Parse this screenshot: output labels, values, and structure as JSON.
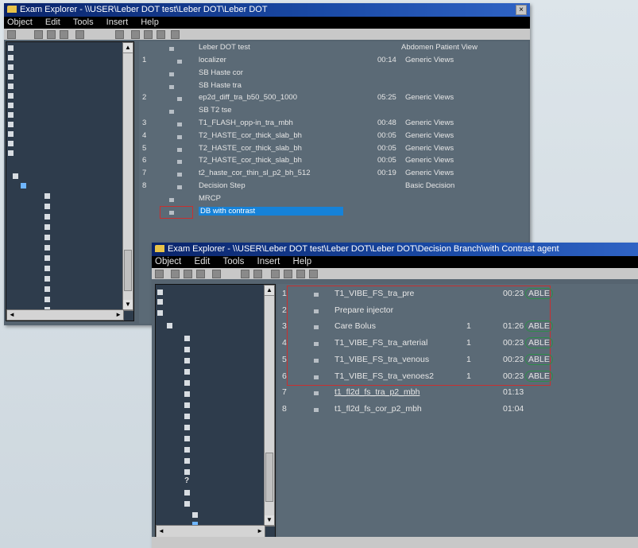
{
  "window1": {
    "title": "Exam Explorer - \\\\USER\\Leber DOT test\\Leber DOT\\Leber DOT",
    "close_glyph": "×",
    "menu": [
      "Object",
      "Edit",
      "Tools",
      "Insert",
      "Help"
    ],
    "header": {
      "name": "Leber DOT test",
      "view": "Abdomen Patient View"
    },
    "rows": [
      {
        "num": "1",
        "name": "localizer",
        "time": "00:14",
        "type": "Generic Views"
      },
      {
        "num": "",
        "name": "SB Haste cor",
        "time": "",
        "type": ""
      },
      {
        "num": "",
        "name": "SB Haste tra",
        "time": "",
        "type": ""
      },
      {
        "num": "2",
        "name": "ep2d_diff_tra_b50_500_1000",
        "time": "05:25",
        "type": "Generic Views"
      },
      {
        "num": "",
        "name": "SB T2 tse",
        "time": "",
        "type": ""
      },
      {
        "num": "3",
        "name": "T1_FLASH_opp-in_tra_mbh",
        "time": "00:48",
        "type": "Generic Views"
      },
      {
        "num": "4",
        "name": "T2_HASTE_cor_thick_slab_bh",
        "time": "00:05",
        "type": "Generic Views"
      },
      {
        "num": "5",
        "name": "T2_HASTE_cor_thick_slab_bh",
        "time": "00:05",
        "type": "Generic Views"
      },
      {
        "num": "6",
        "name": "T2_HASTE_cor_thick_slab_bh",
        "time": "00:05",
        "type": "Generic Views"
      },
      {
        "num": "7",
        "name": "t2_haste_cor_thin_sl_p2_bh_512",
        "time": "00:19",
        "type": "Generic Views"
      },
      {
        "num": "8",
        "name": "Decision Step",
        "time": "",
        "type": "Basic Decision"
      },
      {
        "num": "",
        "name": "MRCP",
        "time": "",
        "type": ""
      },
      {
        "num": "",
        "name": "DB with contrast",
        "time": "",
        "type": ""
      }
    ]
  },
  "window2": {
    "title": "Exam Explorer - \\\\USER\\Leber DOT test\\Leber DOT\\Leber DOT\\Decision Branch\\with Contrast agent",
    "menu": [
      "Object",
      "Edit",
      "Tools",
      "Insert",
      "Help"
    ],
    "rows": [
      {
        "num": "1",
        "name": "T1_VIBE_FS_tra_pre",
        "tag": "",
        "time": "00:23",
        "status": "ABLE"
      },
      {
        "num": "2",
        "name": "Prepare injector",
        "tag": "",
        "time": "",
        "status": ""
      },
      {
        "num": "3",
        "name": "Care Bolus",
        "tag": "1",
        "time": "01:26",
        "status": "ABLE"
      },
      {
        "num": "4",
        "name": "T1_VIBE_FS_tra_arterial",
        "tag": "1",
        "time": "00:23",
        "status": "ABLE"
      },
      {
        "num": "5",
        "name": "T1_VIBE_FS_tra_venous",
        "tag": "1",
        "time": "00:23",
        "status": "ABLE"
      },
      {
        "num": "6",
        "name": "T1_VIBE_FS_tra_venoes2",
        "tag": "1",
        "time": "00:23",
        "status": "ABLE"
      },
      {
        "num": "7",
        "name": "t1_fl2d_fs_tra_p2_mbh",
        "tag": "",
        "time": "01:13",
        "status": ""
      },
      {
        "num": "8",
        "name": "t1_fl2d_fs_cor_p2_mbh",
        "tag": "",
        "time": "01:04",
        "status": ""
      }
    ],
    "tree_question": "?"
  },
  "scroll_glyphs": {
    "up": "▲",
    "down": "▼",
    "left": "◄",
    "right": "►"
  }
}
